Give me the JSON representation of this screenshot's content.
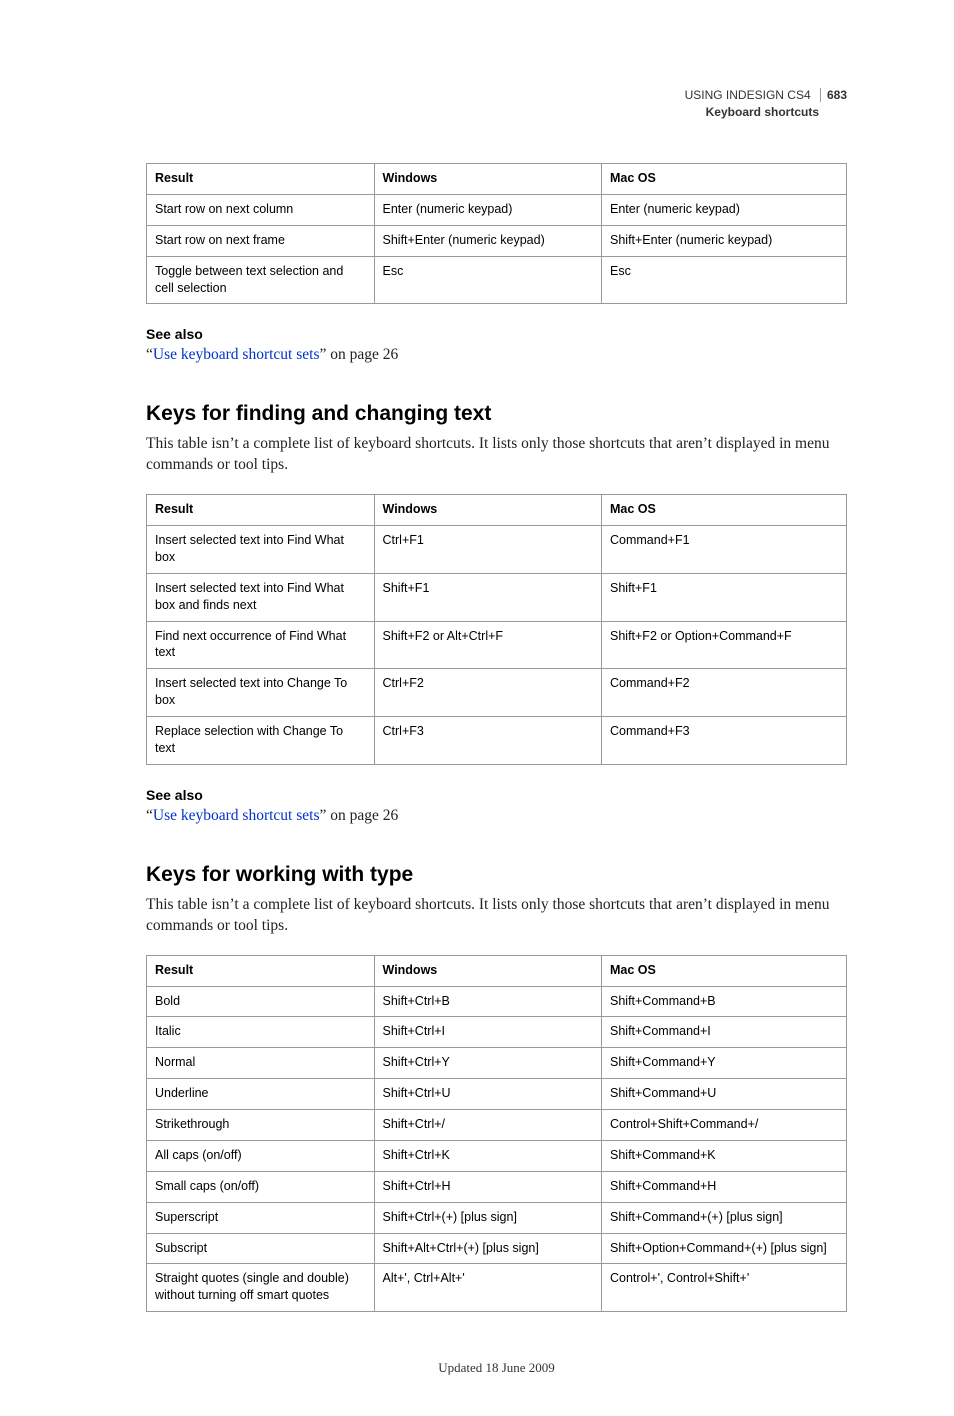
{
  "header": {
    "doc_title": "USING INDESIGN CS4",
    "section_title": "Keyboard shortcuts",
    "page_num": "683"
  },
  "table1": {
    "headers": {
      "result": "Result",
      "windows": "Windows",
      "mac": "Mac OS"
    },
    "rows": [
      {
        "result": "Start row on next column",
        "windows": "Enter (numeric keypad)",
        "mac": "Enter (numeric keypad)"
      },
      {
        "result": "Start row on next frame",
        "windows": "Shift+Enter (numeric keypad)",
        "mac": "Shift+Enter (numeric keypad)"
      },
      {
        "result": "Toggle between text selection and cell selection",
        "windows": "Esc",
        "mac": "Esc"
      }
    ]
  },
  "seealso1": {
    "heading": "See also",
    "prefix": "“",
    "link": "Use keyboard shortcut sets",
    "suffix": "” on page 26"
  },
  "section2": {
    "heading": "Keys for finding and changing text",
    "intro": "This table isn’t a complete list of keyboard shortcuts. It lists only those shortcuts that aren’t displayed in menu commands or tool tips."
  },
  "table2": {
    "headers": {
      "result": "Result",
      "windows": "Windows",
      "mac": "Mac OS"
    },
    "rows": [
      {
        "result": "Insert selected text into Find What box",
        "windows": "Ctrl+F1",
        "mac": "Command+F1"
      },
      {
        "result": "Insert selected text into Find What box and finds next",
        "windows": "Shift+F1",
        "mac": "Shift+F1"
      },
      {
        "result": "Find next occurrence of Find What text",
        "windows": "Shift+F2 or Alt+Ctrl+F",
        "mac": "Shift+F2 or Option+Command+F"
      },
      {
        "result": "Insert selected text into Change To box",
        "windows": "Ctrl+F2",
        "mac": "Command+F2"
      },
      {
        "result": "Replace selection with Change To text",
        "windows": "Ctrl+F3",
        "mac": "Command+F3"
      }
    ]
  },
  "seealso2": {
    "heading": "See also",
    "prefix": "“",
    "link": "Use keyboard shortcut sets",
    "suffix": "” on page 26"
  },
  "section3": {
    "heading": "Keys for working with type",
    "intro": "This table isn’t a complete list of keyboard shortcuts. It lists only those shortcuts that aren’t displayed in menu commands or tool tips."
  },
  "table3": {
    "headers": {
      "result": "Result",
      "windows": "Windows",
      "mac": "Mac OS"
    },
    "rows": [
      {
        "result": "Bold",
        "windows": "Shift+Ctrl+B",
        "mac": "Shift+Command+B"
      },
      {
        "result": "Italic",
        "windows": "Shift+Ctrl+I",
        "mac": "Shift+Command+I"
      },
      {
        "result": "Normal",
        "windows": "Shift+Ctrl+Y",
        "mac": "Shift+Command+Y"
      },
      {
        "result": "Underline",
        "windows": "Shift+Ctrl+U",
        "mac": "Shift+Command+U"
      },
      {
        "result": "Strikethrough",
        "windows": "Shift+Ctrl+/",
        "mac": "Control+Shift+Command+/"
      },
      {
        "result": "All caps (on/off)",
        "windows": "Shift+Ctrl+K",
        "mac": "Shift+Command+K"
      },
      {
        "result": "Small caps (on/off)",
        "windows": "Shift+Ctrl+H",
        "mac": "Shift+Command+H"
      },
      {
        "result": "Superscript",
        "windows": "Shift+Ctrl+(+) [plus sign]",
        "mac": "Shift+Command+(+) [plus sign]"
      },
      {
        "result": "Subscript",
        "windows": "Shift+Alt+Ctrl+(+) [plus sign]",
        "mac": "Shift+Option+Command+(+) [plus sign]"
      },
      {
        "result": "Straight quotes (single and double) without turning off smart quotes",
        "windows": "Alt+', Ctrl+Alt+'",
        "mac": "Control+', Control+Shift+'"
      }
    ]
  },
  "footer": {
    "updated": "Updated 18 June 2009"
  }
}
